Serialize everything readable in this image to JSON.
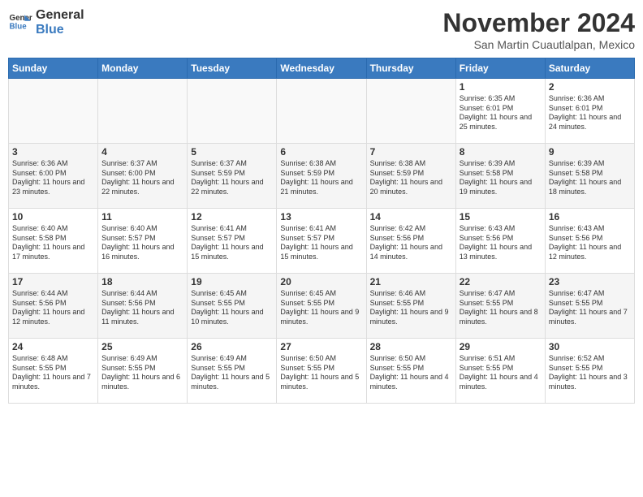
{
  "header": {
    "logo_general": "General",
    "logo_blue": "Blue",
    "month": "November 2024",
    "location": "San Martin Cuautlalpan, Mexico"
  },
  "days_of_week": [
    "Sunday",
    "Monday",
    "Tuesday",
    "Wednesday",
    "Thursday",
    "Friday",
    "Saturday"
  ],
  "weeks": [
    [
      {
        "day": "",
        "info": ""
      },
      {
        "day": "",
        "info": ""
      },
      {
        "day": "",
        "info": ""
      },
      {
        "day": "",
        "info": ""
      },
      {
        "day": "",
        "info": ""
      },
      {
        "day": "1",
        "info": "Sunrise: 6:35 AM\nSunset: 6:01 PM\nDaylight: 11 hours and 25 minutes."
      },
      {
        "day": "2",
        "info": "Sunrise: 6:36 AM\nSunset: 6:01 PM\nDaylight: 11 hours and 24 minutes."
      }
    ],
    [
      {
        "day": "3",
        "info": "Sunrise: 6:36 AM\nSunset: 6:00 PM\nDaylight: 11 hours and 23 minutes."
      },
      {
        "day": "4",
        "info": "Sunrise: 6:37 AM\nSunset: 6:00 PM\nDaylight: 11 hours and 22 minutes."
      },
      {
        "day": "5",
        "info": "Sunrise: 6:37 AM\nSunset: 5:59 PM\nDaylight: 11 hours and 22 minutes."
      },
      {
        "day": "6",
        "info": "Sunrise: 6:38 AM\nSunset: 5:59 PM\nDaylight: 11 hours and 21 minutes."
      },
      {
        "day": "7",
        "info": "Sunrise: 6:38 AM\nSunset: 5:59 PM\nDaylight: 11 hours and 20 minutes."
      },
      {
        "day": "8",
        "info": "Sunrise: 6:39 AM\nSunset: 5:58 PM\nDaylight: 11 hours and 19 minutes."
      },
      {
        "day": "9",
        "info": "Sunrise: 6:39 AM\nSunset: 5:58 PM\nDaylight: 11 hours and 18 minutes."
      }
    ],
    [
      {
        "day": "10",
        "info": "Sunrise: 6:40 AM\nSunset: 5:58 PM\nDaylight: 11 hours and 17 minutes."
      },
      {
        "day": "11",
        "info": "Sunrise: 6:40 AM\nSunset: 5:57 PM\nDaylight: 11 hours and 16 minutes."
      },
      {
        "day": "12",
        "info": "Sunrise: 6:41 AM\nSunset: 5:57 PM\nDaylight: 11 hours and 15 minutes."
      },
      {
        "day": "13",
        "info": "Sunrise: 6:41 AM\nSunset: 5:57 PM\nDaylight: 11 hours and 15 minutes."
      },
      {
        "day": "14",
        "info": "Sunrise: 6:42 AM\nSunset: 5:56 PM\nDaylight: 11 hours and 14 minutes."
      },
      {
        "day": "15",
        "info": "Sunrise: 6:43 AM\nSunset: 5:56 PM\nDaylight: 11 hours and 13 minutes."
      },
      {
        "day": "16",
        "info": "Sunrise: 6:43 AM\nSunset: 5:56 PM\nDaylight: 11 hours and 12 minutes."
      }
    ],
    [
      {
        "day": "17",
        "info": "Sunrise: 6:44 AM\nSunset: 5:56 PM\nDaylight: 11 hours and 12 minutes."
      },
      {
        "day": "18",
        "info": "Sunrise: 6:44 AM\nSunset: 5:56 PM\nDaylight: 11 hours and 11 minutes."
      },
      {
        "day": "19",
        "info": "Sunrise: 6:45 AM\nSunset: 5:55 PM\nDaylight: 11 hours and 10 minutes."
      },
      {
        "day": "20",
        "info": "Sunrise: 6:45 AM\nSunset: 5:55 PM\nDaylight: 11 hours and 9 minutes."
      },
      {
        "day": "21",
        "info": "Sunrise: 6:46 AM\nSunset: 5:55 PM\nDaylight: 11 hours and 9 minutes."
      },
      {
        "day": "22",
        "info": "Sunrise: 6:47 AM\nSunset: 5:55 PM\nDaylight: 11 hours and 8 minutes."
      },
      {
        "day": "23",
        "info": "Sunrise: 6:47 AM\nSunset: 5:55 PM\nDaylight: 11 hours and 7 minutes."
      }
    ],
    [
      {
        "day": "24",
        "info": "Sunrise: 6:48 AM\nSunset: 5:55 PM\nDaylight: 11 hours and 7 minutes."
      },
      {
        "day": "25",
        "info": "Sunrise: 6:49 AM\nSunset: 5:55 PM\nDaylight: 11 hours and 6 minutes."
      },
      {
        "day": "26",
        "info": "Sunrise: 6:49 AM\nSunset: 5:55 PM\nDaylight: 11 hours and 5 minutes."
      },
      {
        "day": "27",
        "info": "Sunrise: 6:50 AM\nSunset: 5:55 PM\nDaylight: 11 hours and 5 minutes."
      },
      {
        "day": "28",
        "info": "Sunrise: 6:50 AM\nSunset: 5:55 PM\nDaylight: 11 hours and 4 minutes."
      },
      {
        "day": "29",
        "info": "Sunrise: 6:51 AM\nSunset: 5:55 PM\nDaylight: 11 hours and 4 minutes."
      },
      {
        "day": "30",
        "info": "Sunrise: 6:52 AM\nSunset: 5:55 PM\nDaylight: 11 hours and 3 minutes."
      }
    ]
  ]
}
